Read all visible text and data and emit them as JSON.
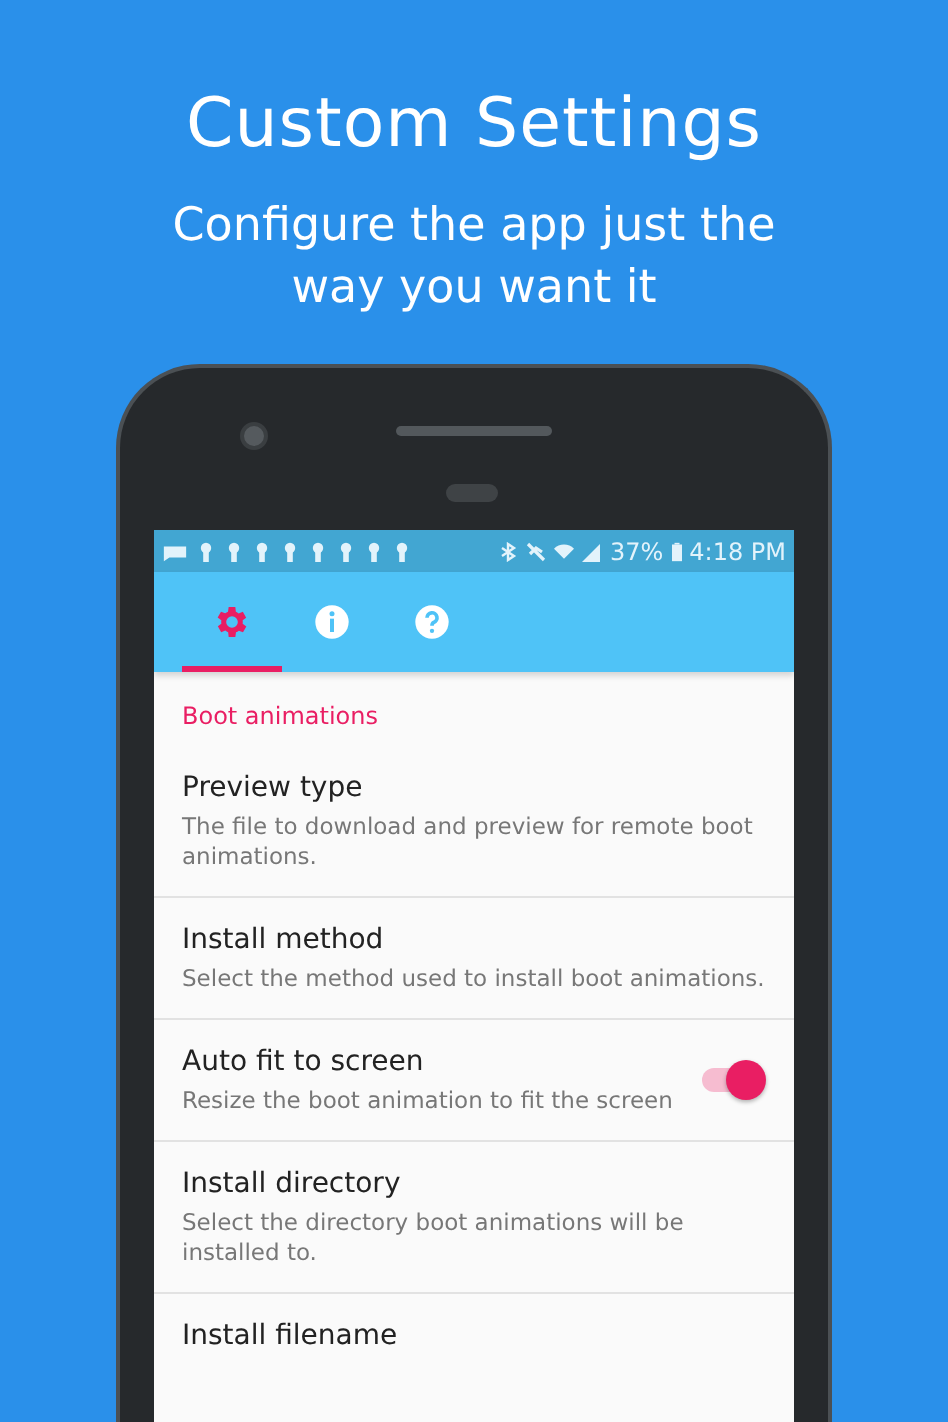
{
  "headline": "Custom Settings",
  "subheadline": "Configure the app just the way you want it",
  "status_bar": {
    "battery": "37%",
    "time": "4:18 PM"
  },
  "tabs": [
    {
      "kind": "settings",
      "selected": true
    },
    {
      "kind": "info",
      "selected": false
    },
    {
      "kind": "help",
      "selected": false
    }
  ],
  "category": "Boot animations",
  "settings": [
    {
      "title": "Preview type",
      "summary": "The file to download and preview for remote boot animations."
    },
    {
      "title": "Install method",
      "summary": "Select the method used to install boot animations."
    },
    {
      "title": "Auto fit to screen",
      "summary": "Resize the boot animation to fit the screen",
      "switch": {
        "on": true
      }
    },
    {
      "title": "Install directory",
      "summary": "Select the directory boot animations will be installed to."
    },
    {
      "title": "Install filename"
    }
  ]
}
